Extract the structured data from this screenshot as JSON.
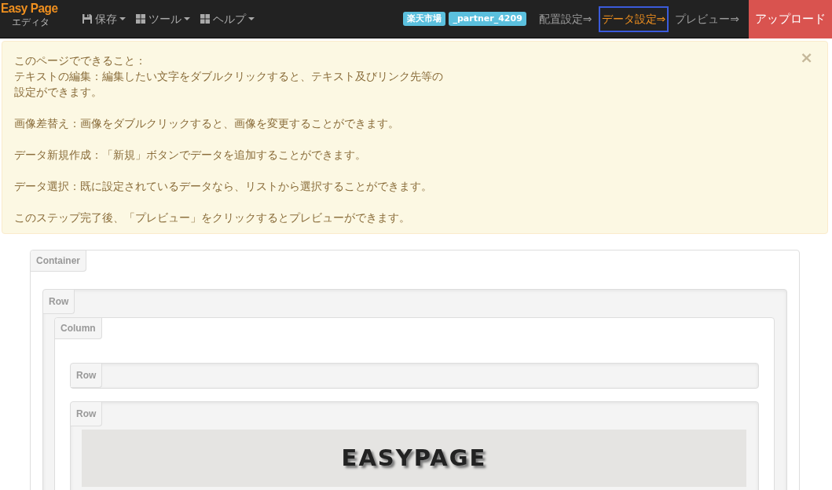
{
  "navbar": {
    "brand": "Easy Page",
    "brand_sub": "エディタ",
    "menus": [
      {
        "label": "保存",
        "kind": "save"
      },
      {
        "label": "ツール",
        "kind": "grid"
      },
      {
        "label": "ヘルプ",
        "kind": "grid"
      }
    ],
    "badges": [
      "楽天市場",
      "_partner_4209"
    ],
    "steps": [
      {
        "label": "配置設定⇒",
        "selected": false
      },
      {
        "label": "データ設定⇒",
        "selected": true
      },
      {
        "label": "プレビュー⇒",
        "selected": false
      }
    ],
    "upload_button": "アップロード"
  },
  "alert": {
    "close": "×",
    "paragraphs": [
      [
        "このページでできること：",
        "テキストの編集：編集したい文字をダブルクリックすると、テキスト及びリンク先等の",
        "設定ができます。"
      ],
      [
        "画像差替え：画像をダブルクリックすると、画像を変更することができます。"
      ],
      [
        "データ新規作成：「新規」ボタンでデータを追加することができます。"
      ],
      [
        "データ選択：既に設定されているデータなら、リストから選択することができます。"
      ],
      [
        "このステップ完了後、「プレビュー」をクリックするとプレビューができます。"
      ]
    ]
  },
  "layout": [
    {
      "kind": "container",
      "label": "Container",
      "children": [
        {
          "kind": "row",
          "label": "Row",
          "children": [
            {
              "kind": "column",
              "label": "Column",
              "children": [
                {
                  "kind": "row",
                  "label": "Row"
                },
                {
                  "kind": "row",
                  "label": "Row",
                  "children": [
                    {
                      "kind": "banner",
                      "text": "EASYPAGE"
                    }
                  ]
                }
              ]
            }
          ]
        }
      ]
    }
  ]
}
